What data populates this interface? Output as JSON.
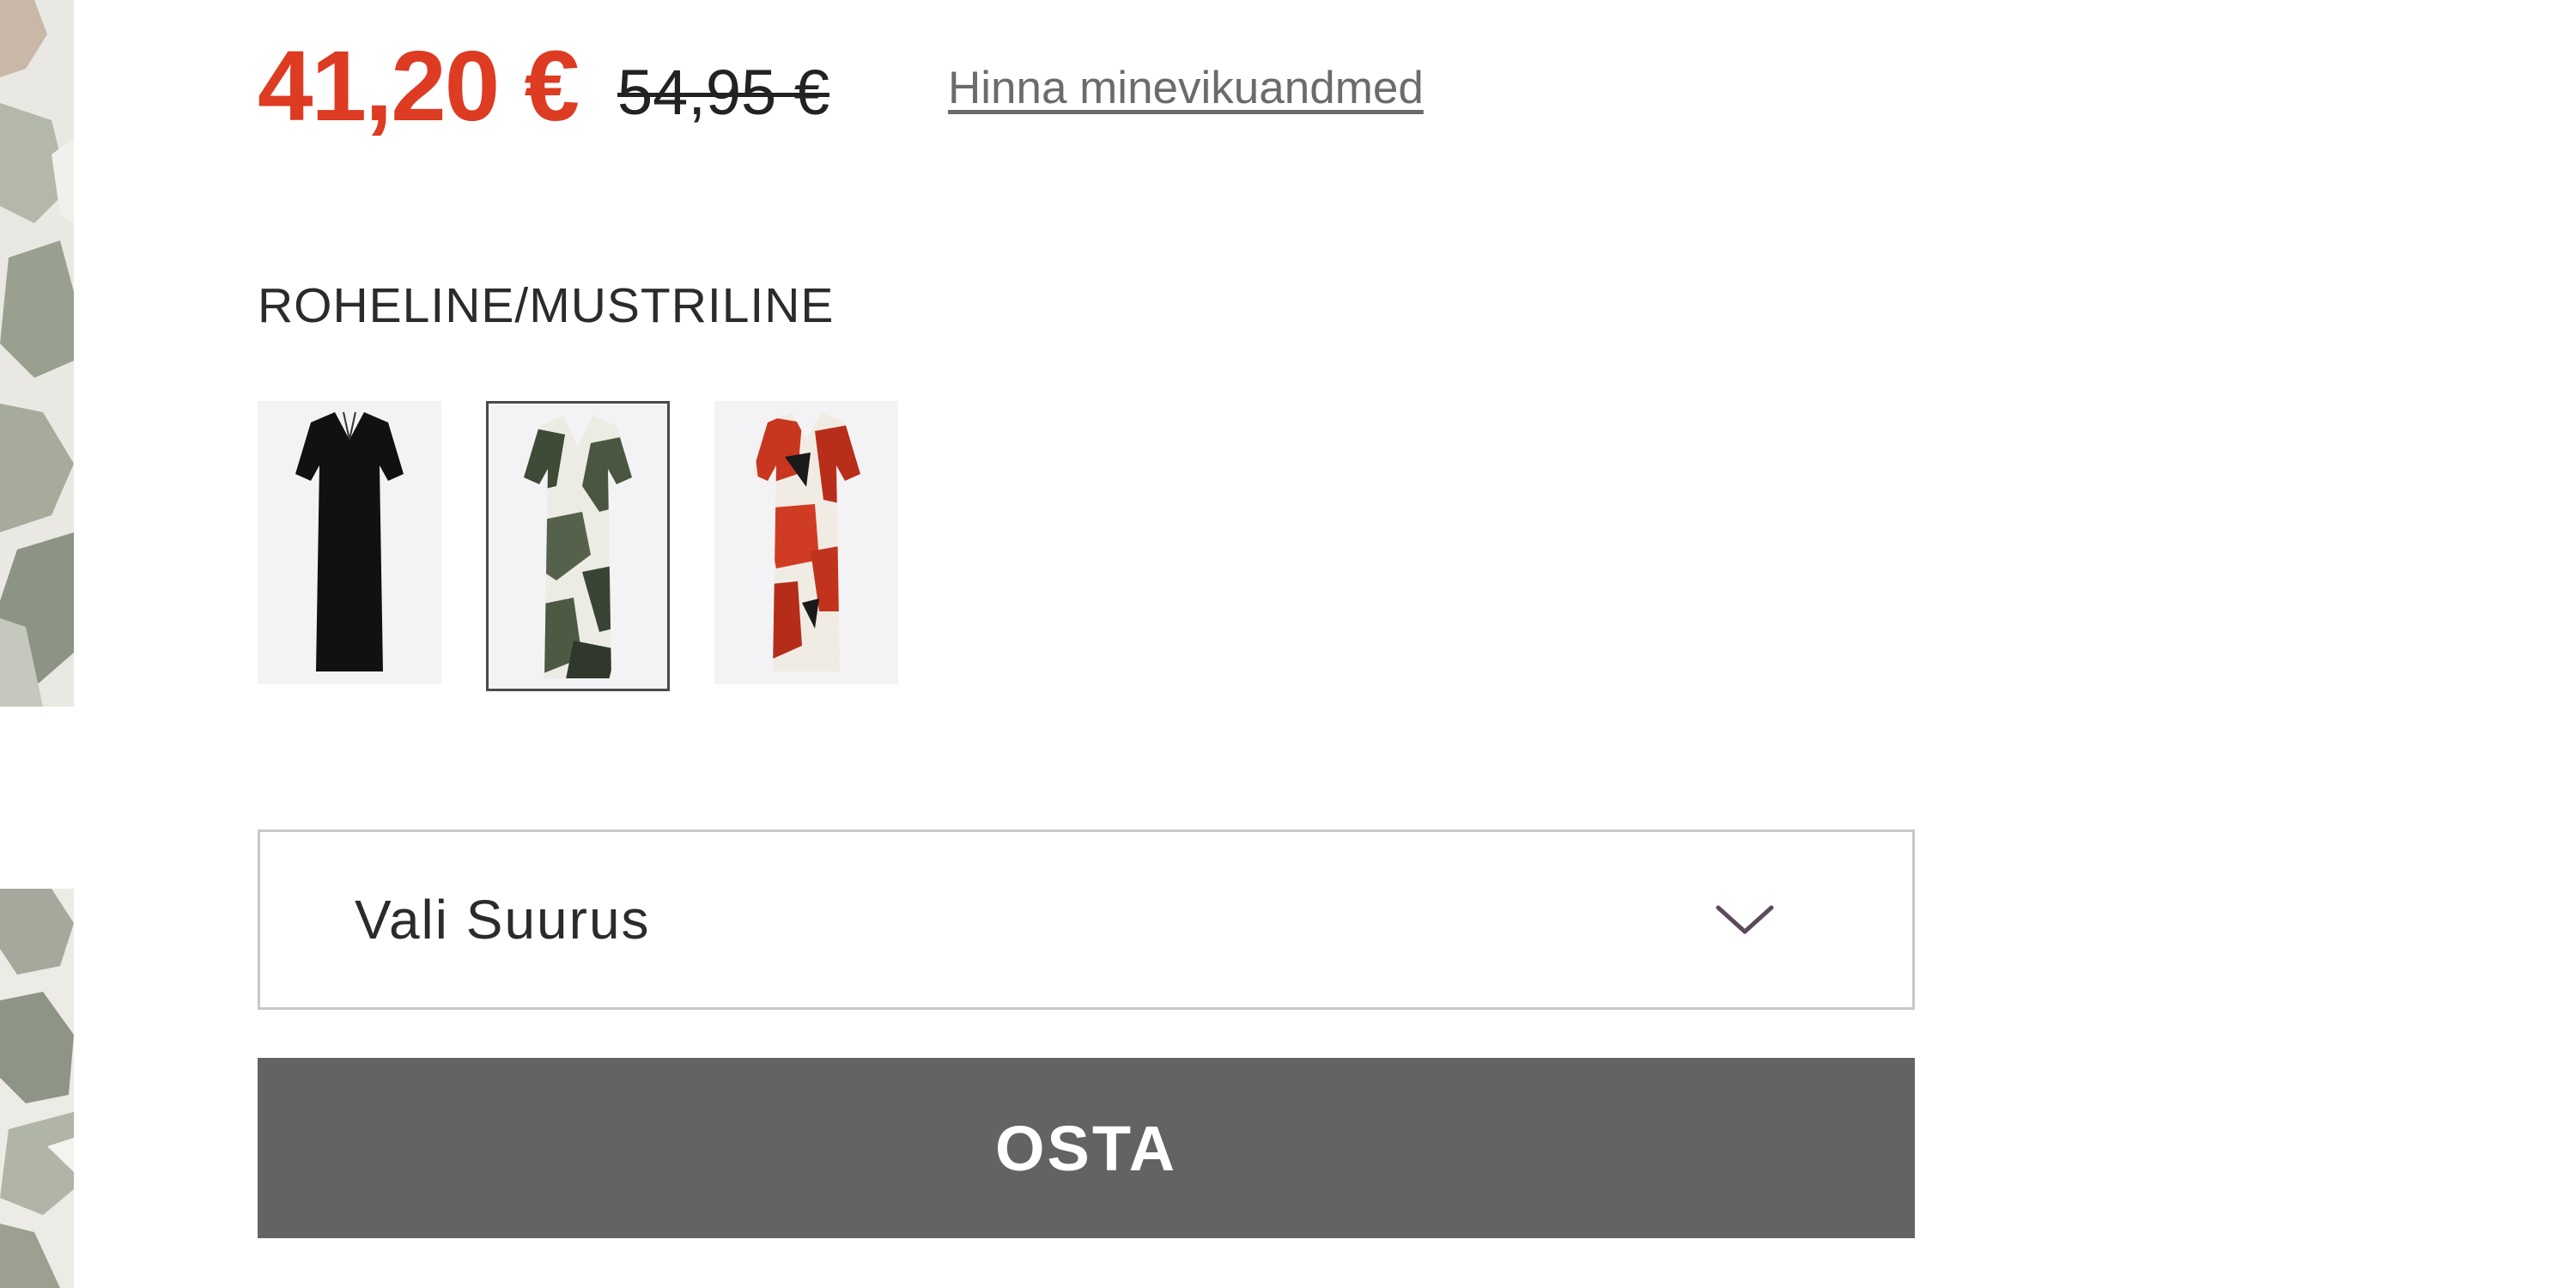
{
  "price": {
    "current": "41,20 €",
    "original": "54,95 €",
    "history_link": "Hinna minevikuandmed",
    "sale_color": "#dd3b22"
  },
  "color": {
    "selected_label": "ROHELINE/MUSTRILINE",
    "swatches": [
      {
        "icon": "black-dress-thumbnail",
        "selected": false
      },
      {
        "icon": "green-print-dress-thumbnail",
        "selected": true
      },
      {
        "icon": "red-print-dress-thumbnail",
        "selected": false
      }
    ]
  },
  "size_select": {
    "label": "Vali Suurus",
    "icon": "chevron-down-icon"
  },
  "buy_button": {
    "label": "OSTA",
    "background": "#636363"
  }
}
